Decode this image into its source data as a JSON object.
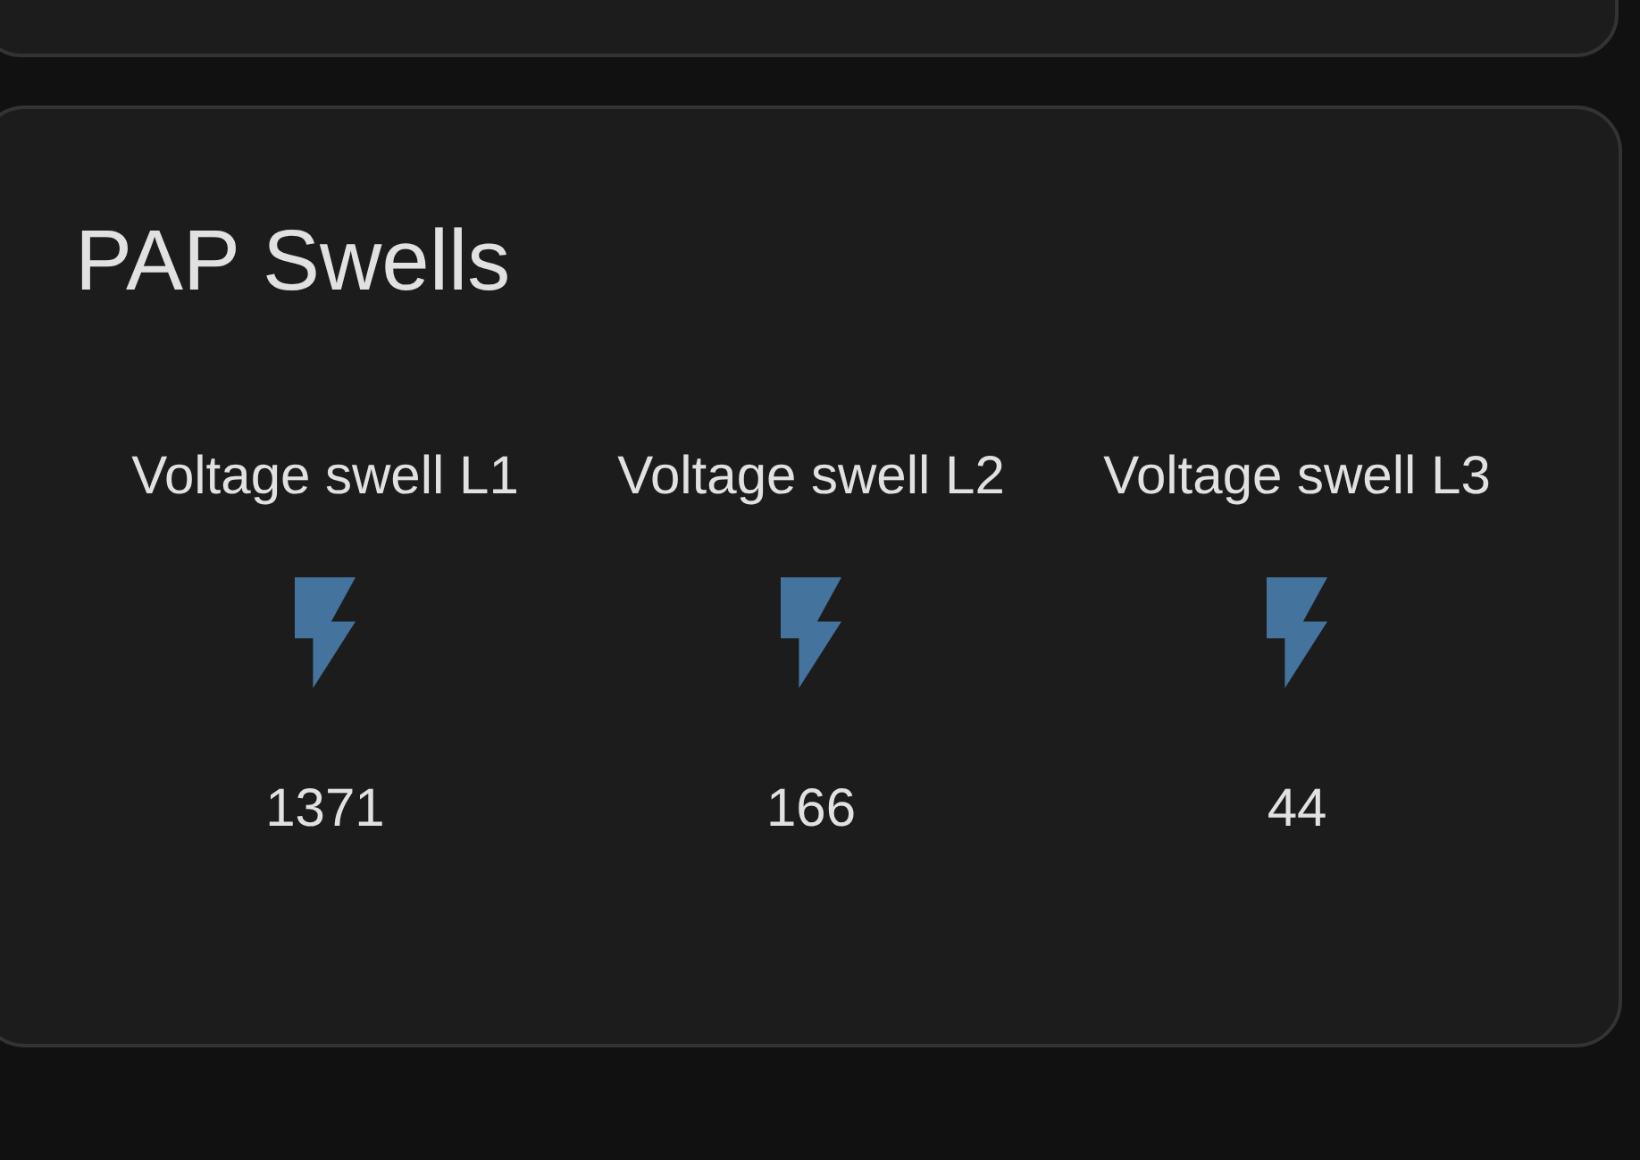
{
  "card": {
    "title": "PAP Swells",
    "entities": [
      {
        "name": "Voltage swell L1",
        "value": "1371"
      },
      {
        "name": "Voltage swell L2",
        "value": "166"
      },
      {
        "name": "Voltage swell L3",
        "value": "44"
      }
    ]
  }
}
